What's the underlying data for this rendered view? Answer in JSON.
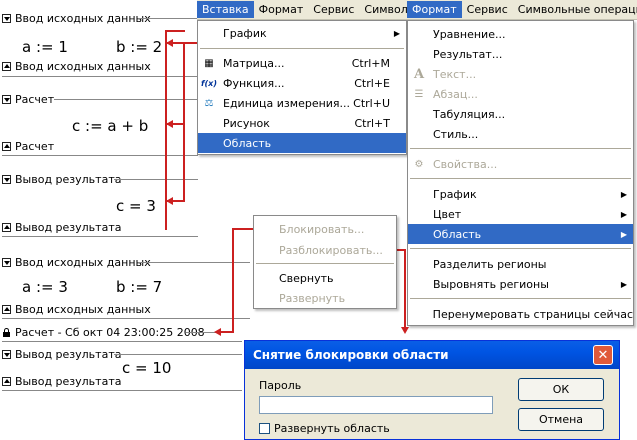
{
  "worksheet": {
    "headers": {
      "input1_open": "Ввод исходных данных",
      "input1_close": "Ввод исходных данных",
      "calc1_open": "Расчет",
      "calc1_close": "Расчет",
      "output1_open": "Вывод результата",
      "output1_close": "Вывод результата",
      "input2_open": "Ввод исходных данных",
      "input2_close": "Ввод исходных данных",
      "calc2_locked": "Расчет - Сб окт 04 23:00:25 2008",
      "output2_open": "Вывод результата",
      "output2_close": "Вывод результата"
    },
    "math": {
      "a1": "a := 1",
      "b1": "b := 2",
      "c_def": "c := a + b",
      "c1": "c = 3",
      "a2": "a := 3",
      "b2": "b := 7",
      "c2": "c = 10"
    }
  },
  "insert_menu": {
    "menubar": [
      "Вставка",
      "Формат",
      "Сервис",
      "Символьные"
    ],
    "items": [
      {
        "label": "График",
        "shortcut": "",
        "icon": "",
        "submenu": true
      },
      {
        "label": "Матрица...",
        "shortcut": "Ctrl+M",
        "icon": "matrix-icon"
      },
      {
        "label": "Функция...",
        "shortcut": "Ctrl+E",
        "icon": "fx-icon"
      },
      {
        "label": "Единица измерения...",
        "shortcut": "Ctrl+U",
        "icon": "units-icon"
      },
      {
        "label": "Рисунок",
        "shortcut": "Ctrl+T",
        "icon": ""
      },
      {
        "label": "Область",
        "shortcut": "",
        "icon": ""
      }
    ],
    "fx_glyph": "f(x)"
  },
  "format_menu": {
    "menubar": [
      "Формат",
      "Сервис",
      "Символьные операции"
    ],
    "items": [
      {
        "label": "Уравнение..."
      },
      {
        "label": "Результат..."
      },
      {
        "label": "Текст..."
      },
      {
        "label": "Абзац..."
      },
      {
        "label": "Табуляция..."
      },
      {
        "label": "Стиль..."
      },
      {
        "label": "Свойства..."
      },
      {
        "label": "График"
      },
      {
        "label": "Цвет"
      },
      {
        "label": "Область"
      },
      {
        "label": "Разделить регионы"
      },
      {
        "label": "Выровнять регионы"
      },
      {
        "label": "Перенумеровать страницы сейчас"
      }
    ],
    "text_glyph": "A"
  },
  "context_menu": {
    "items": [
      {
        "label": "Блокировать...",
        "enabled": false
      },
      {
        "label": "Разблокировать...",
        "enabled": false
      },
      {
        "label": "Свернуть",
        "enabled": true
      },
      {
        "label": "Развернуть",
        "enabled": false
      }
    ]
  },
  "dialog": {
    "title": "Снятие блокировки области",
    "password_label": "Пароль",
    "password_value": "",
    "expand_label": "Развернуть область",
    "ok": "ОК",
    "cancel": "Отмена",
    "close": "✕"
  },
  "colors": {
    "highlight": "#316ac5",
    "arrow": "#cc2020",
    "titlebar": "#0054e3"
  }
}
